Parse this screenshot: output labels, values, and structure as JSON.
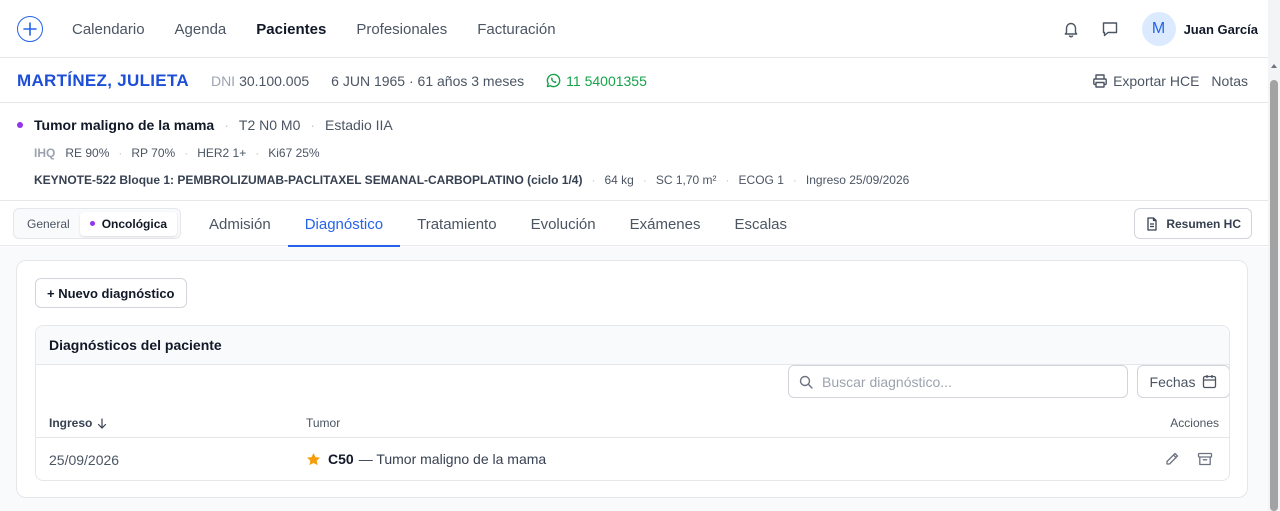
{
  "nav": {
    "links": [
      "Calendario",
      "Agenda",
      "Pacientes",
      "Profesionales",
      "Facturación"
    ],
    "active": "Pacientes",
    "user": {
      "initial": "M",
      "name": "Juan García"
    },
    "icons": [
      "plus-circle-icon",
      "bell-icon",
      "chat-icon"
    ]
  },
  "patient": {
    "name": "MARTÍNEZ, JULIETA",
    "dni_label": "DNI",
    "dni": "30.100.005",
    "dob": "6 JUN 1965 · 61 años 3 meses",
    "phone": "11 54001355",
    "export_label": "Exportar HCE",
    "notes_label": "Notas"
  },
  "diagnosis_summary": {
    "tumor": "Tumor maligno de la mama",
    "tnm": "T2 N0 M0",
    "stage": "Estadio IIA",
    "ihq_label": "IHQ",
    "ihq": [
      "RE 90%",
      "RP 70%",
      "HER2 1+",
      "Ki67 25%"
    ],
    "protocol": "KEYNOTE-522 Bloque 1: PEMBROLIZUMAB-PACLITAXEL SEMANAL-CARBOPLATINO (ciclo 1/4)",
    "weight": "64 kg",
    "sc": "SC 1,70 m²",
    "ecog": "ECOG 1",
    "admission": "Ingreso 25/09/2026"
  },
  "tabs": {
    "segment": [
      "General",
      "Oncológica"
    ],
    "segment_active": "Oncológica",
    "items": [
      "Admisión",
      "Diagnóstico",
      "Tratamiento",
      "Evolución",
      "Exámenes",
      "Escalas"
    ],
    "active": "Diagnóstico",
    "summary_button": "Resumen HC"
  },
  "diagnoses": {
    "new_button": "+ Nuevo diagnóstico",
    "panel_title": "Diagnósticos del paciente",
    "search_placeholder": "Buscar diagnóstico...",
    "dates_button": "Fechas",
    "columns": {
      "ingreso": "Ingreso",
      "tumor": "Tumor",
      "acciones": "Acciones"
    },
    "rows": [
      {
        "date": "25/09/2026",
        "code": "C50",
        "description": "— Tumor maligno de la mama"
      }
    ]
  },
  "colors": {
    "accent": "#2563eb",
    "patient_name": "#1d4ed8",
    "whatsapp": "#16a34a",
    "oncology_dot": "#9333ea",
    "star": "#f59e0b"
  }
}
